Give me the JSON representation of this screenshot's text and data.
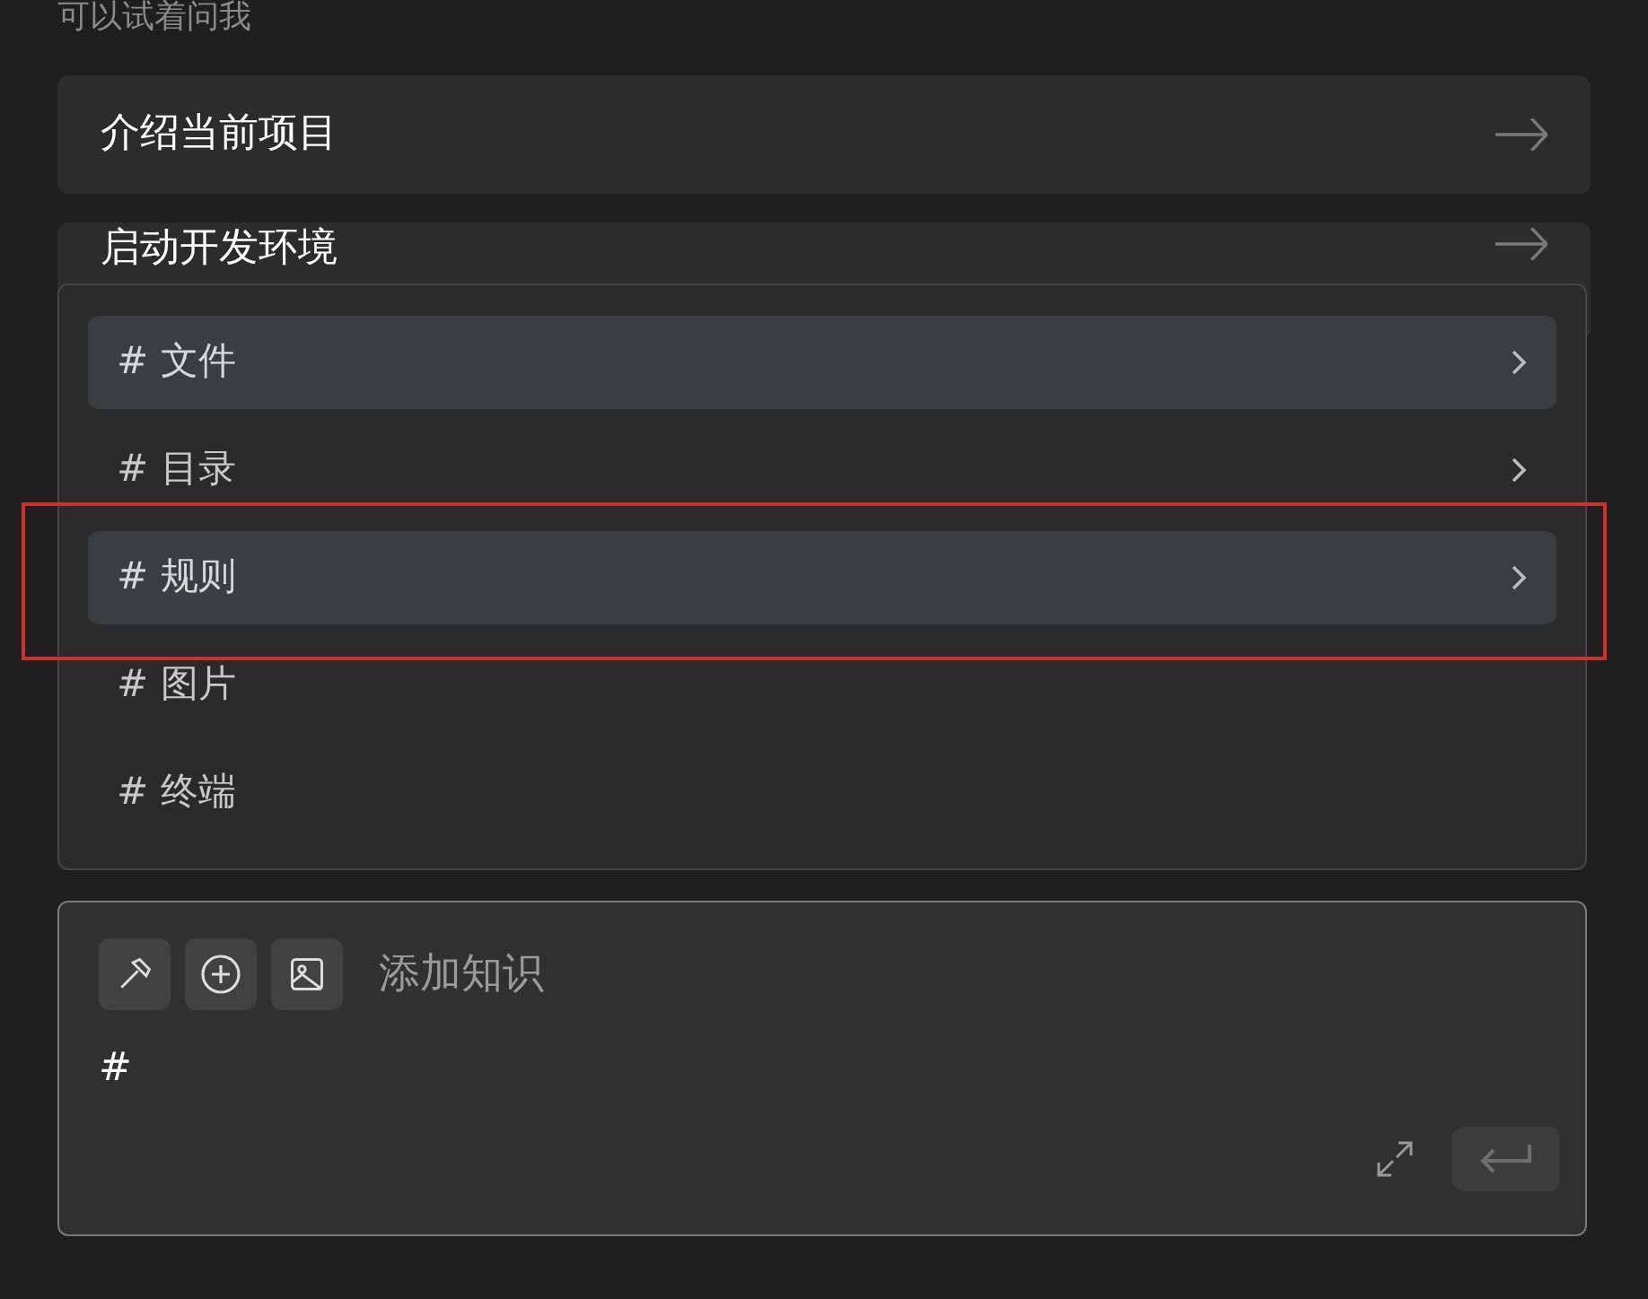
{
  "prompt_heading": "可以试着问我",
  "suggestions": [
    {
      "label": "介绍当前项目"
    },
    {
      "label": "启动开发环境"
    }
  ],
  "mention_menu": {
    "items": [
      {
        "label": "# 文件",
        "highlighted": true,
        "has_submenu": true,
        "annotated": false
      },
      {
        "label": "# 目录",
        "highlighted": false,
        "has_submenu": true,
        "annotated": false
      },
      {
        "label": "# 规则",
        "highlighted": true,
        "has_submenu": true,
        "annotated": true
      },
      {
        "label": "# 图片",
        "highlighted": false,
        "has_submenu": false,
        "annotated": false
      },
      {
        "label": "# 终端",
        "highlighted": false,
        "has_submenu": false,
        "annotated": false
      }
    ]
  },
  "composer": {
    "add_knowledge_label": "添加知识",
    "value": "#"
  }
}
